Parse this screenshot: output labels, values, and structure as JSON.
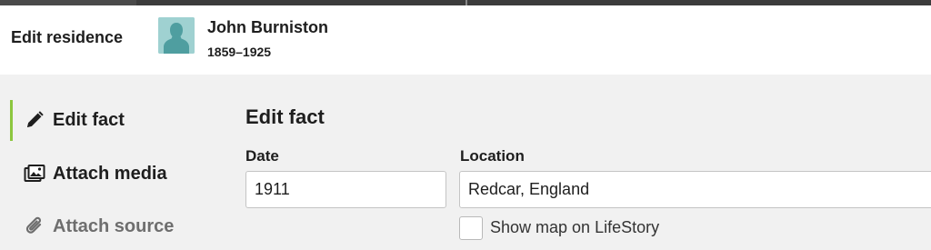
{
  "header": {
    "title": "Edit residence",
    "person": {
      "name": "John Burniston",
      "dates": "1859–1925",
      "avatar_icon": "person-silhouette-icon"
    }
  },
  "sidebar": {
    "items": [
      {
        "label": "Edit fact",
        "icon": "pencil-icon",
        "active": true
      },
      {
        "label": "Attach media",
        "icon": "media-icon",
        "active": false
      },
      {
        "label": "Attach source",
        "icon": "paperclip-icon",
        "active": false
      }
    ]
  },
  "main": {
    "section_title": "Edit fact",
    "date": {
      "label": "Date",
      "value": "1911"
    },
    "location": {
      "label": "Location",
      "value": "Redcar, England"
    },
    "show_map": {
      "label": "Show map on LifeStory",
      "checked": false
    }
  },
  "colors": {
    "accent": "#8cc63f",
    "avatar_bg": "#9fd1d1",
    "avatar_fg": "#4f9ea0",
    "background": "#f1f1f1"
  }
}
